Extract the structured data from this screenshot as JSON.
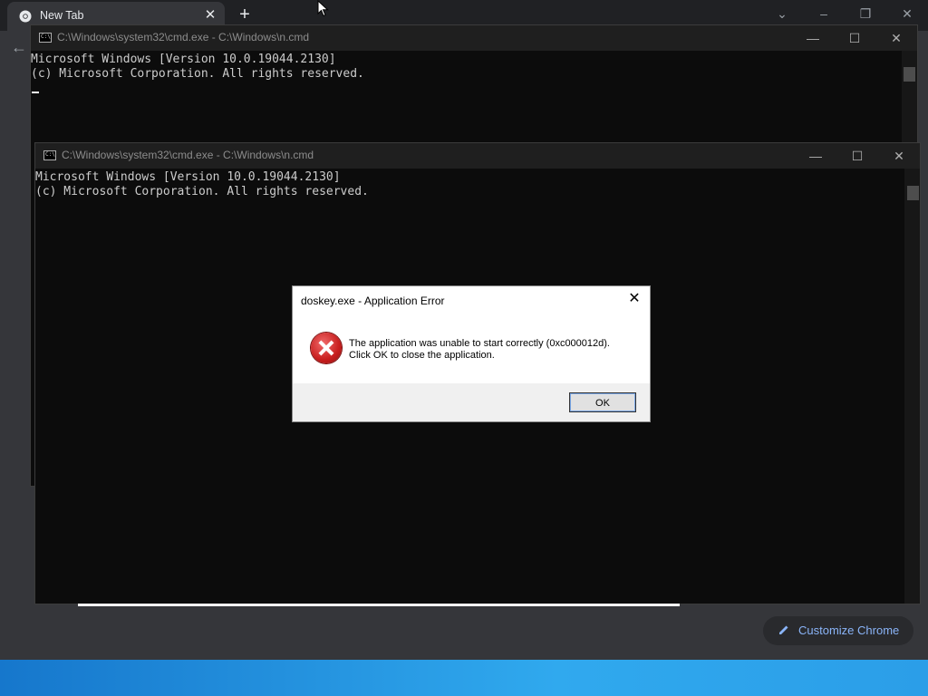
{
  "chrome": {
    "tab_title": "New Tab",
    "tab_close": "✕",
    "new_tab": "+",
    "minimize": "–",
    "restore": "❐",
    "close": "✕",
    "dropdown": "⌄",
    "back": "←",
    "customize_label": "Customize Chrome"
  },
  "cmd_back": {
    "title": "C:\\Windows\\system32\\cmd.exe - C:\\Windows\\n.cmd",
    "icon_text": "C:\\",
    "lines": [
      "Microsoft Windows [Version 10.0.19044.2130]",
      "(c) Microsoft Corporation. All rights reserved."
    ]
  },
  "cmd_front": {
    "title": "C:\\Windows\\system32\\cmd.exe - C:\\Windows\\n.cmd",
    "icon_text": "C:\\",
    "lines": [
      "Microsoft Windows [Version 10.0.19044.2130]",
      "(c) Microsoft Corporation. All rights reserved."
    ]
  },
  "window_buttons": {
    "minimize": "—",
    "maximize": "☐",
    "close": "✕"
  },
  "dialog": {
    "title": "doskey.exe - Application Error",
    "close": "✕",
    "message_line1": "The application was unable to start correctly (0xc000012d).",
    "message_line2": "Click OK to close the application.",
    "ok_label": "OK",
    "icon": "error-icon"
  },
  "colors": {
    "chrome_bg": "#202124",
    "cmd_bg": "#0c0c0c",
    "taskbar": "#1677cc",
    "link_blue": "#8ab4f8"
  }
}
